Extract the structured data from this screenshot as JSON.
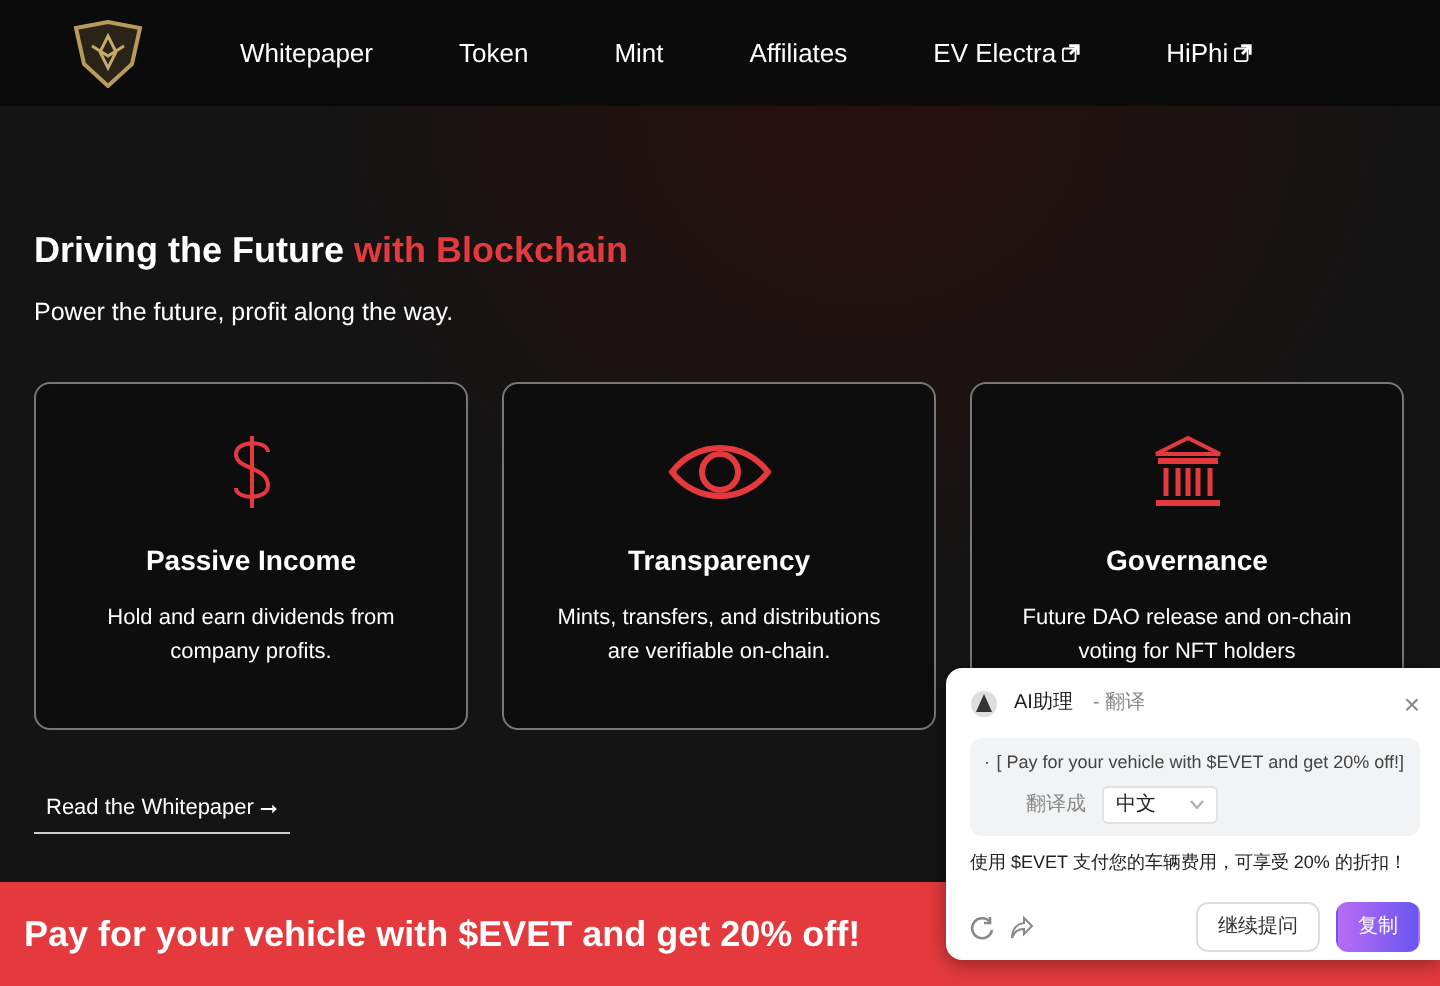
{
  "nav": {
    "items": [
      {
        "label": "Whitepaper",
        "external": false
      },
      {
        "label": "Token",
        "external": false
      },
      {
        "label": "Mint",
        "external": false
      },
      {
        "label": "Affiliates",
        "external": false
      },
      {
        "label": "EV Electra",
        "external": true
      },
      {
        "label": "HiPhi",
        "external": true
      }
    ]
  },
  "hero": {
    "title": "Driving the Future **with Blockchain**",
    "subtitle": "Power the future, profit along the way.",
    "features": [
      {
        "kind": "dollar",
        "title": "Passive Income",
        "text": "Hold and earn dividends from company profits."
      },
      {
        "kind": "eye",
        "title": "Transparency",
        "text": "Mints, transfers, and distributions are verifiable on-chain."
      },
      {
        "kind": "bank",
        "title": "Governance",
        "text": "Future DAO release and on-chain voting for NFT holders"
      }
    ],
    "link": "Read the Whitepaper ⭢"
  },
  "banner": {
    "text": "Pay for your vehicle with $EVET and get 20% off!"
  },
  "popup": {
    "title": "AI助理",
    "mode": "- 翻译",
    "close": "×",
    "source": "[ Pay for your vehicle with $EVET and get 20% off!]",
    "target_label": "翻译成",
    "language": "中文",
    "result": "使用 $EVET 支付您的车辆费用，可享受 20% 的折扣！",
    "buttons": [
      {
        "label": "继续提问",
        "primary": false
      },
      {
        "label": "复制",
        "primary": true
      }
    ]
  }
}
